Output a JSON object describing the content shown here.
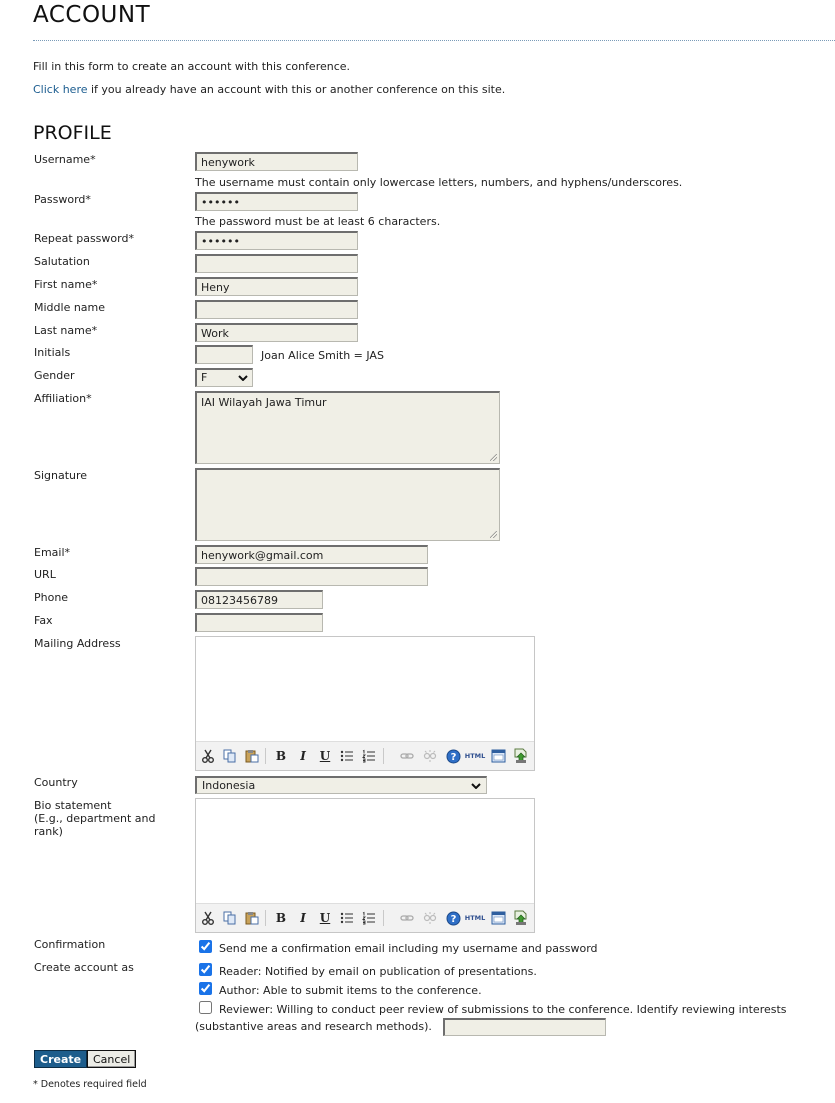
{
  "page": {
    "title": "ACCOUNT",
    "intro": "Fill in this form to create an account with this conference.",
    "login_link": "Click here",
    "login_text": " if you already have an account with this or another conference on this site.",
    "section_title": "PROFILE",
    "required_note": "* Denotes required field"
  },
  "form": {
    "username": {
      "label": "Username*",
      "value": "henywork",
      "help": "The username must contain only lowercase letters, numbers, and hyphens/underscores."
    },
    "password": {
      "label": "Password*",
      "value": "••••••",
      "help": "The password must be at least 6 characters."
    },
    "repeat_password": {
      "label": "Repeat password*",
      "value": "••••••"
    },
    "salutation": {
      "label": "Salutation",
      "value": ""
    },
    "first_name": {
      "label": "First name*",
      "value": "Heny"
    },
    "middle_name": {
      "label": "Middle name",
      "value": ""
    },
    "last_name": {
      "label": "Last name*",
      "value": "Work"
    },
    "initials": {
      "label": "Initials",
      "value": "",
      "help": "Joan Alice Smith = JAS"
    },
    "gender": {
      "label": "Gender",
      "value": "F"
    },
    "affiliation": {
      "label": "Affiliation*",
      "value": "IAI Wilayah Jawa Timur"
    },
    "signature": {
      "label": "Signature",
      "value": ""
    },
    "email": {
      "label": "Email*",
      "value": "henywork@gmail.com"
    },
    "url": {
      "label": "URL",
      "value": ""
    },
    "phone": {
      "label": "Phone",
      "value": "08123456789"
    },
    "fax": {
      "label": "Fax",
      "value": ""
    },
    "mailing_address": {
      "label": "Mailing Address",
      "value": ""
    },
    "country": {
      "label": "Country",
      "value": "Indonesia"
    },
    "bio": {
      "label": "Bio statement",
      "label_sub": "(E.g., department and rank)",
      "value": ""
    },
    "confirmation": {
      "label": "Confirmation",
      "text": "Send me a confirmation email including my username and password",
      "checked": true
    },
    "create_as": {
      "label": "Create account as",
      "reader": {
        "text": "Reader: Notified by email on publication of presentations.",
        "checked": true
      },
      "author": {
        "text": "Author: Able to submit items to the conference.",
        "checked": true
      },
      "reviewer": {
        "text": "Reviewer: Willing to conduct peer review of submissions to the conference. Identify reviewing interests",
        "text2": "(substantive areas and research methods).",
        "checked": false,
        "interests_value": ""
      }
    }
  },
  "editor_toolbar": {
    "icons": [
      "cut-icon",
      "copy-icon",
      "paste-icon",
      "bold-icon",
      "italic-icon",
      "underline-icon",
      "bullet-list-icon",
      "numbered-list-icon",
      "link-icon",
      "unlink-icon",
      "help-icon",
      "html-icon",
      "fullscreen-icon",
      "image-upload-icon"
    ],
    "bold": "B",
    "italic": "I",
    "underline": "U",
    "html": "HTML"
  },
  "buttons": {
    "create": "Create",
    "cancel": "Cancel"
  },
  "colors": {
    "link": "#1b5c8f",
    "create_button": "#1d5d8c",
    "field_bg": "#f0efe6"
  }
}
